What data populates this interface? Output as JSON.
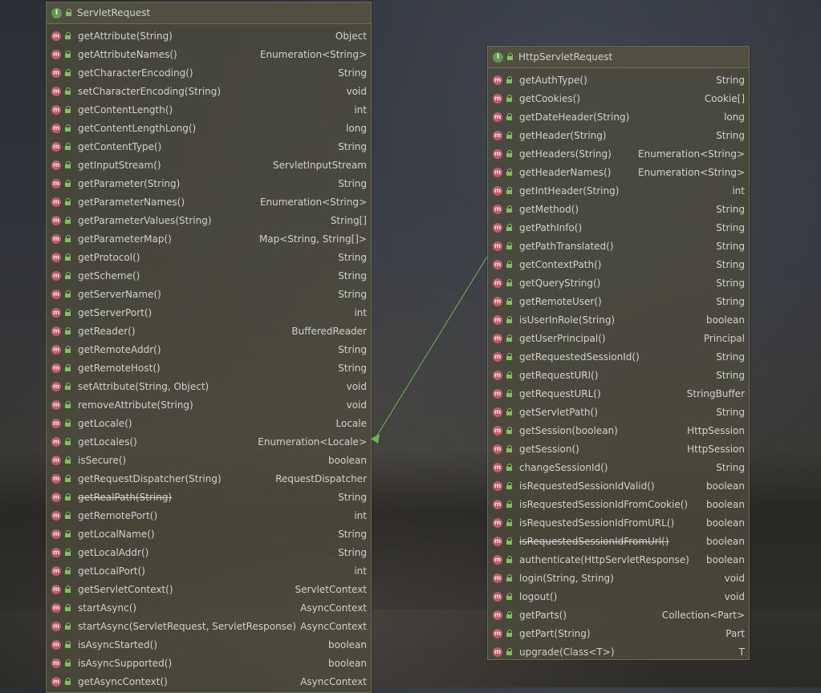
{
  "servlet_request": {
    "title": "ServletRequest",
    "methods": [
      {
        "name": "getAttribute(String)",
        "type": "Object"
      },
      {
        "name": "getAttributeNames()",
        "type": "Enumeration<String>"
      },
      {
        "name": "getCharacterEncoding()",
        "type": "String"
      },
      {
        "name": "setCharacterEncoding(String)",
        "type": "void"
      },
      {
        "name": "getContentLength()",
        "type": "int"
      },
      {
        "name": "getContentLengthLong()",
        "type": "long"
      },
      {
        "name": "getContentType()",
        "type": "String"
      },
      {
        "name": "getInputStream()",
        "type": "ServletInputStream"
      },
      {
        "name": "getParameter(String)",
        "type": "String"
      },
      {
        "name": "getParameterNames()",
        "type": "Enumeration<String>"
      },
      {
        "name": "getParameterValues(String)",
        "type": "String[]"
      },
      {
        "name": "getParameterMap()",
        "type": "Map<String, String[]>"
      },
      {
        "name": "getProtocol()",
        "type": "String"
      },
      {
        "name": "getScheme()",
        "type": "String"
      },
      {
        "name": "getServerName()",
        "type": "String"
      },
      {
        "name": "getServerPort()",
        "type": "int"
      },
      {
        "name": "getReader()",
        "type": "BufferedReader"
      },
      {
        "name": "getRemoteAddr()",
        "type": "String"
      },
      {
        "name": "getRemoteHost()",
        "type": "String"
      },
      {
        "name": "setAttribute(String, Object)",
        "type": "void"
      },
      {
        "name": "removeAttribute(String)",
        "type": "void"
      },
      {
        "name": "getLocale()",
        "type": "Locale"
      },
      {
        "name": "getLocales()",
        "type": "Enumeration<Locale>"
      },
      {
        "name": "isSecure()",
        "type": "boolean"
      },
      {
        "name": "getRequestDispatcher(String)",
        "type": "RequestDispatcher"
      },
      {
        "name": "getRealPath(String)",
        "type": "String",
        "deprecated": true
      },
      {
        "name": "getRemotePort()",
        "type": "int"
      },
      {
        "name": "getLocalName()",
        "type": "String"
      },
      {
        "name": "getLocalAddr()",
        "type": "String"
      },
      {
        "name": "getLocalPort()",
        "type": "int"
      },
      {
        "name": "getServletContext()",
        "type": "ServletContext"
      },
      {
        "name": "startAsync()",
        "type": "AsyncContext"
      },
      {
        "name": "startAsync(ServletRequest, ServletResponse)",
        "type": "AsyncContext"
      },
      {
        "name": "isAsyncStarted()",
        "type": "boolean"
      },
      {
        "name": "isAsyncSupported()",
        "type": "boolean"
      },
      {
        "name": "getAsyncContext()",
        "type": "AsyncContext"
      }
    ]
  },
  "http_servlet_request": {
    "title": "HttpServletRequest",
    "methods": [
      {
        "name": "getAuthType()",
        "type": "String"
      },
      {
        "name": "getCookies()",
        "type": "Cookie[]"
      },
      {
        "name": "getDateHeader(String)",
        "type": "long"
      },
      {
        "name": "getHeader(String)",
        "type": "String"
      },
      {
        "name": "getHeaders(String)",
        "type": "Enumeration<String>"
      },
      {
        "name": "getHeaderNames()",
        "type": "Enumeration<String>"
      },
      {
        "name": "getIntHeader(String)",
        "type": "int"
      },
      {
        "name": "getMethod()",
        "type": "String"
      },
      {
        "name": "getPathInfo()",
        "type": "String"
      },
      {
        "name": "getPathTranslated()",
        "type": "String"
      },
      {
        "name": "getContextPath()",
        "type": "String"
      },
      {
        "name": "getQueryString()",
        "type": "String"
      },
      {
        "name": "getRemoteUser()",
        "type": "String"
      },
      {
        "name": "isUserInRole(String)",
        "type": "boolean"
      },
      {
        "name": "getUserPrincipal()",
        "type": "Principal"
      },
      {
        "name": "getRequestedSessionId()",
        "type": "String"
      },
      {
        "name": "getRequestURI()",
        "type": "String"
      },
      {
        "name": "getRequestURL()",
        "type": "StringBuffer"
      },
      {
        "name": "getServletPath()",
        "type": "String"
      },
      {
        "name": "getSession(boolean)",
        "type": "HttpSession"
      },
      {
        "name": "getSession()",
        "type": "HttpSession"
      },
      {
        "name": "changeSessionId()",
        "type": "String"
      },
      {
        "name": "isRequestedSessionIdValid()",
        "type": "boolean"
      },
      {
        "name": "isRequestedSessionIdFromCookie()",
        "type": "boolean"
      },
      {
        "name": "isRequestedSessionIdFromURL()",
        "type": "boolean"
      },
      {
        "name": "isRequestedSessionIdFromUrl()",
        "type": "boolean",
        "deprecated": true
      },
      {
        "name": "authenticate(HttpServletResponse)",
        "type": "boolean"
      },
      {
        "name": "login(String, String)",
        "type": "void"
      },
      {
        "name": "logout()",
        "type": "void"
      },
      {
        "name": "getParts()",
        "type": "Collection<Part>"
      },
      {
        "name": "getPart(String)",
        "type": "Part"
      },
      {
        "name": "upgrade(Class<T>)",
        "type": "T"
      }
    ]
  },
  "badges": {
    "interface": "I",
    "method": "m"
  },
  "colors": {
    "interface_badge": "#5f9a4e",
    "method_badge": "#c25a6a",
    "arrow": "#6fb35a",
    "lock": "#7fc15a"
  }
}
